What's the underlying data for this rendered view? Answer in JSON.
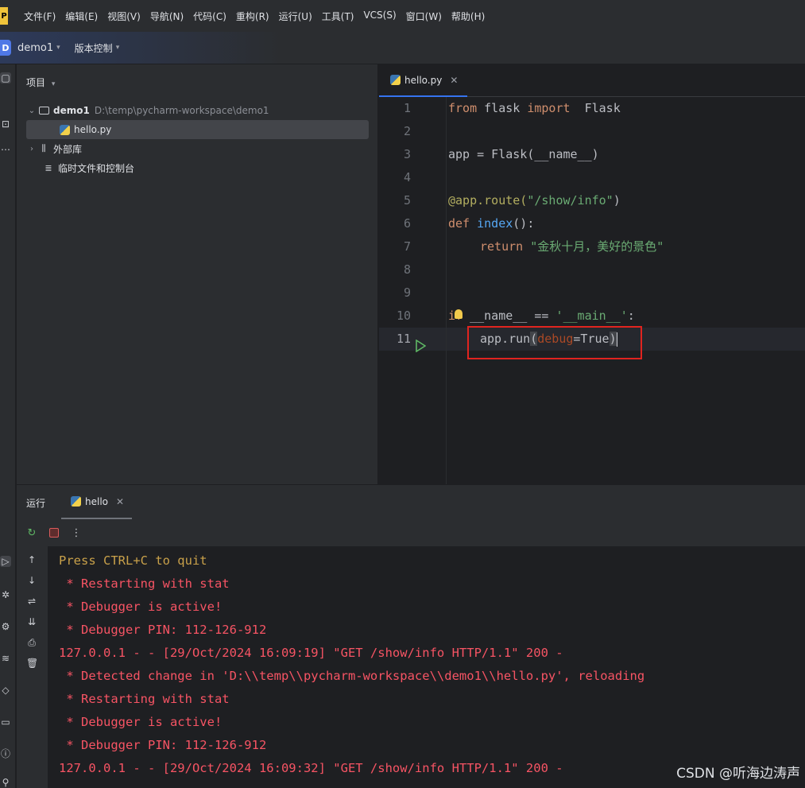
{
  "menubar": {
    "logo": "P",
    "items": [
      "文件(F)",
      "编辑(E)",
      "视图(V)",
      "导航(N)",
      "代码(C)",
      "重构(R)",
      "运行(U)",
      "工具(T)",
      "VCS(S)",
      "窗口(W)",
      "帮助(H)"
    ]
  },
  "toolbar": {
    "project_badge": "D",
    "project_name": "demo1",
    "vcs_label": "版本控制"
  },
  "project_panel": {
    "header": "项目",
    "tree": {
      "root_name": "demo1",
      "root_path": "D:\\temp\\pycharm-workspace\\demo1",
      "file": "hello.py",
      "external_libs": "外部库",
      "scratches": "临时文件和控制台"
    }
  },
  "editor": {
    "tab_label": "hello.py",
    "line_numbers": [
      "1",
      "2",
      "3",
      "4",
      "5",
      "6",
      "7",
      "8",
      "9",
      "10",
      "11"
    ],
    "code": {
      "l1_kw1": "from",
      "l1_mod": " flask ",
      "l1_kw2": "import",
      "l1_name": "  Flask",
      "l3": "app = Flask(__name__)",
      "l5_dec": "@app.route(",
      "l5_str": "\"/show/info\"",
      "l5_end": ")",
      "l6_kw": "def",
      "l6_fn": " index",
      "l6_end": "():",
      "l7_kw": "return",
      "l7_str": "\"金秋十月，美好的景色\"",
      "l10_kw": "if",
      "l10_rest": " __name__ == ",
      "l10_str": "'__main__'",
      "l10_end": ":",
      "l11_a": "app.run",
      "l11_p1": "(",
      "l11_param": "debug",
      "l11_eq": "=True",
      "l11_p2": ")"
    }
  },
  "run_panel": {
    "title": "运行",
    "tab_label": "hello",
    "console_lines": [
      "Press CTRL+C to quit",
      " * Restarting with stat",
      " * Debugger is active!",
      " * Debugger PIN: 112-126-912",
      "127.0.0.1 - - [29/Oct/2024 16:09:19] \"GET /show/info HTTP/1.1\" 200 -",
      " * Detected change in 'D:\\\\temp\\\\pycharm-workspace\\\\demo1\\\\hello.py', reloading",
      " * Restarting with stat",
      " * Debugger is active!",
      " * Debugger PIN: 112-126-912",
      "127.0.0.1 - - [29/Oct/2024 16:09:32] \"GET /show/info HTTP/1.1\" 200 -"
    ]
  },
  "watermark": "CSDN @听海边涛声",
  "colors": {
    "accent": "#3574f0",
    "highlight_box": "#e0241f",
    "console_error": "#f75464",
    "console_warn": "#c9a14a"
  }
}
